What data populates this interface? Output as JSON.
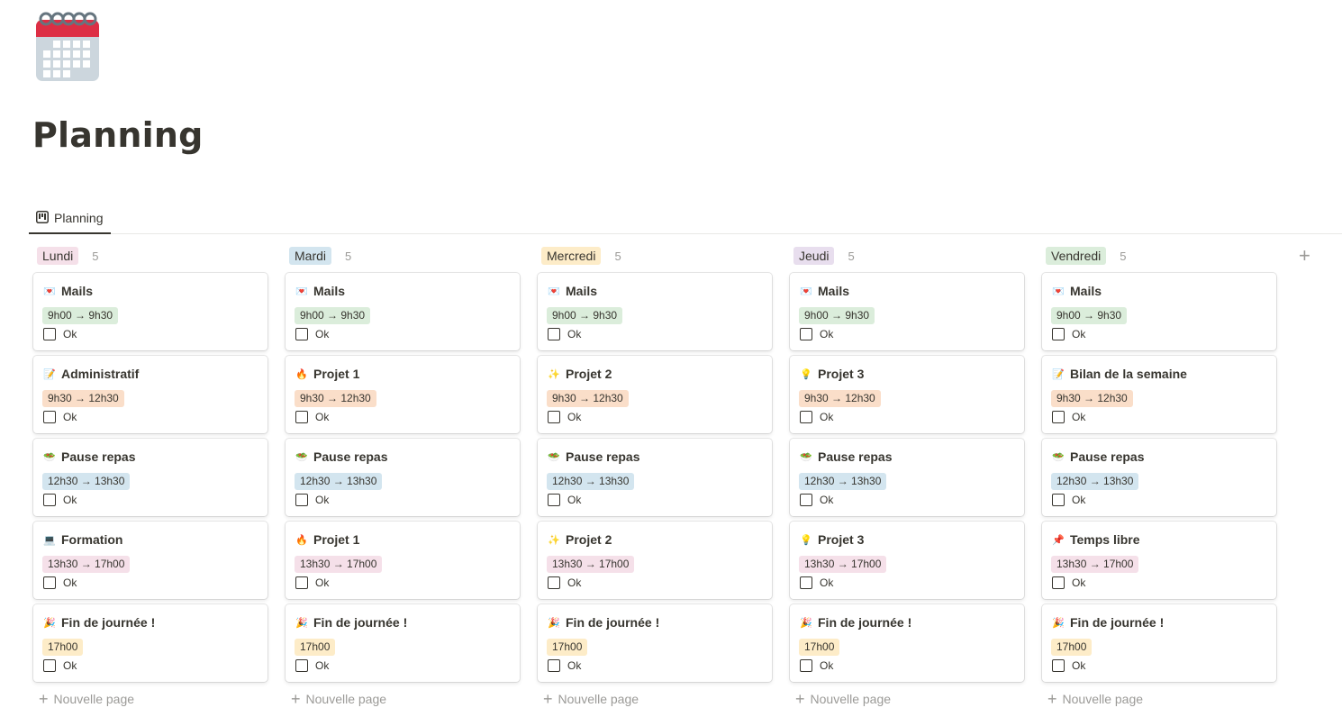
{
  "page": {
    "title": "Planning",
    "icon": "calendar-icon"
  },
  "view_tab": {
    "label": "Planning",
    "icon": "board-view-icon"
  },
  "new_page_label": "Nouvelle page",
  "add_group_icon": "plus-icon",
  "colors": {
    "green_tag": "#dbeddb",
    "orange_tag": "#fadec9",
    "blue_tag": "#d3e5ef",
    "pink_tag": "#f5e0e9",
    "yellow_tag": "#fdecc8",
    "purple_tag": "#e8deee"
  },
  "columns": [
    {
      "name": "Lundi",
      "count": "5",
      "color": "#f5e0e9",
      "cards": [
        {
          "emoji": "💌",
          "icon": "love-letter-icon",
          "title": "Mails",
          "time": "9h00 → 9h30",
          "time_color": "#dbeddb",
          "check": "Ok"
        },
        {
          "emoji": "📝",
          "icon": "memo-icon",
          "title": "Administratif",
          "time": "9h30 → 12h30",
          "time_color": "#fadec9",
          "check": "Ok"
        },
        {
          "emoji": "🥗",
          "icon": "salad-icon",
          "title": "Pause repas",
          "time": "12h30 → 13h30",
          "time_color": "#d3e5ef",
          "check": "Ok"
        },
        {
          "emoji": "💻",
          "icon": "laptop-icon",
          "title": "Formation",
          "time": "13h30 → 17h00",
          "time_color": "#f5e0e9",
          "check": "Ok"
        },
        {
          "emoji": "🎉",
          "icon": "party-popper-icon",
          "title": "Fin de journée !",
          "time": "17h00",
          "time_color": "#fdecc8",
          "check": "Ok"
        }
      ]
    },
    {
      "name": "Mardi",
      "count": "5",
      "color": "#d3e5ef",
      "cards": [
        {
          "emoji": "💌",
          "icon": "love-letter-icon",
          "title": "Mails",
          "time": "9h00 → 9h30",
          "time_color": "#dbeddb",
          "check": "Ok"
        },
        {
          "emoji": "🔥",
          "icon": "fire-icon",
          "title": "Projet 1",
          "time": "9h30 → 12h30",
          "time_color": "#fadec9",
          "check": "Ok"
        },
        {
          "emoji": "🥗",
          "icon": "salad-icon",
          "title": "Pause repas",
          "time": "12h30 → 13h30",
          "time_color": "#d3e5ef",
          "check": "Ok"
        },
        {
          "emoji": "🔥",
          "icon": "fire-icon",
          "title": "Projet 1",
          "time": "13h30 → 17h00",
          "time_color": "#f5e0e9",
          "check": "Ok"
        },
        {
          "emoji": "🎉",
          "icon": "party-popper-icon",
          "title": "Fin de journée !",
          "time": "17h00",
          "time_color": "#fdecc8",
          "check": "Ok"
        }
      ]
    },
    {
      "name": "Mercredi",
      "count": "5",
      "color": "#fdecc8",
      "cards": [
        {
          "emoji": "💌",
          "icon": "love-letter-icon",
          "title": "Mails",
          "time": "9h00 → 9h30",
          "time_color": "#dbeddb",
          "check": "Ok"
        },
        {
          "emoji": "✨",
          "icon": "sparkles-icon",
          "title": "Projet 2",
          "time": "9h30 → 12h30",
          "time_color": "#fadec9",
          "check": "Ok"
        },
        {
          "emoji": "🥗",
          "icon": "salad-icon",
          "title": "Pause repas",
          "time": "12h30 → 13h30",
          "time_color": "#d3e5ef",
          "check": "Ok"
        },
        {
          "emoji": "✨",
          "icon": "sparkles-icon",
          "title": "Projet 2",
          "time": "13h30 → 17h00",
          "time_color": "#f5e0e9",
          "check": "Ok"
        },
        {
          "emoji": "🎉",
          "icon": "party-popper-icon",
          "title": "Fin de journée !",
          "time": "17h00",
          "time_color": "#fdecc8",
          "check": "Ok"
        }
      ]
    },
    {
      "name": "Jeudi",
      "count": "5",
      "color": "#e8deee",
      "cards": [
        {
          "emoji": "💌",
          "icon": "love-letter-icon",
          "title": "Mails",
          "time": "9h00 → 9h30",
          "time_color": "#dbeddb",
          "check": "Ok"
        },
        {
          "emoji": "💡",
          "icon": "light-bulb-icon",
          "title": "Projet 3",
          "time": "9h30 → 12h30",
          "time_color": "#fadec9",
          "check": "Ok"
        },
        {
          "emoji": "🥗",
          "icon": "salad-icon",
          "title": "Pause repas",
          "time": "12h30 → 13h30",
          "time_color": "#d3e5ef",
          "check": "Ok"
        },
        {
          "emoji": "💡",
          "icon": "light-bulb-icon",
          "title": "Projet 3",
          "time": "13h30 → 17h00",
          "time_color": "#f5e0e9",
          "check": "Ok"
        },
        {
          "emoji": "🎉",
          "icon": "party-popper-icon",
          "title": "Fin de journée !",
          "time": "17h00",
          "time_color": "#fdecc8",
          "check": "Ok"
        }
      ]
    },
    {
      "name": "Vendredi",
      "count": "5",
      "color": "#dbeddb",
      "cards": [
        {
          "emoji": "💌",
          "icon": "love-letter-icon",
          "title": "Mails",
          "time": "9h00 → 9h30",
          "time_color": "#dbeddb",
          "check": "Ok"
        },
        {
          "emoji": "📝",
          "icon": "memo-icon",
          "title": "Bilan de la semaine",
          "time": "9h30 → 12h30",
          "time_color": "#fadec9",
          "check": "Ok"
        },
        {
          "emoji": "🥗",
          "icon": "salad-icon",
          "title": "Pause repas",
          "time": "12h30 → 13h30",
          "time_color": "#d3e5ef",
          "check": "Ok"
        },
        {
          "emoji": "📌",
          "icon": "pushpin-icon",
          "title": "Temps libre",
          "time": "13h30 → 17h00",
          "time_color": "#f5e0e9",
          "check": "Ok"
        },
        {
          "emoji": "🎉",
          "icon": "party-popper-icon",
          "title": "Fin de journée !",
          "time": "17h00",
          "time_color": "#fdecc8",
          "check": "Ok"
        }
      ]
    }
  ]
}
